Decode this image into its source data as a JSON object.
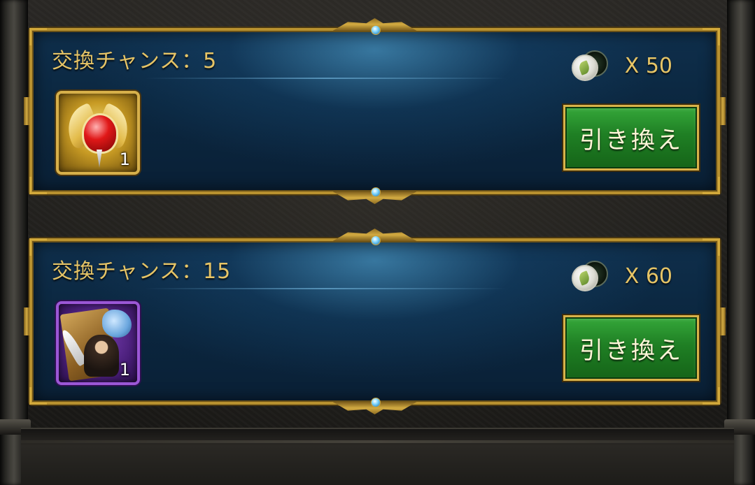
{
  "offers": [
    {
      "chance_label": "交換チャンス：5",
      "cost_text": "X 50",
      "currency_icon": "tea-coin-icon",
      "item_icon": "winged-heart-gem-icon",
      "item_rarity": "gold",
      "item_quantity": "1",
      "button_label": "引き換え"
    },
    {
      "chance_label": "交換チャンス：15",
      "cost_text": "X 60",
      "currency_icon": "tea-coin-icon",
      "item_icon": "hero-portrait-fragment-icon",
      "item_rarity": "purple",
      "item_quantity": "1",
      "button_label": "引き換え"
    }
  ],
  "colors": {
    "frame_gold": "#b8912f",
    "label_gold": "#e6c466",
    "panel_blue": "#0b2740",
    "button_green": "#1f7f24"
  }
}
